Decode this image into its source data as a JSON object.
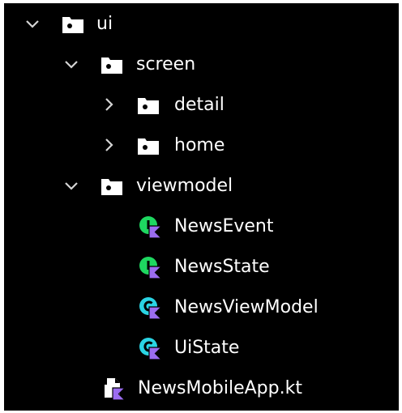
{
  "tree": {
    "ui": {
      "label": "ui",
      "expanded": true,
      "icon": "folder-icon"
    },
    "screen": {
      "label": "screen",
      "expanded": true,
      "icon": "folder-icon"
    },
    "detail": {
      "label": "detail",
      "expanded": false,
      "icon": "package-icon"
    },
    "home": {
      "label": "home",
      "expanded": false,
      "icon": "package-icon"
    },
    "viewmodel": {
      "label": "viewmodel",
      "expanded": true,
      "icon": "folder-icon"
    },
    "news_event": {
      "label": "NewsEvent",
      "icon": "kotlin-interface-icon"
    },
    "news_state": {
      "label": "NewsState",
      "icon": "kotlin-interface-icon"
    },
    "news_view_model": {
      "label": "NewsViewModel",
      "icon": "kotlin-class-icon"
    },
    "ui_state": {
      "label": "UiState",
      "icon": "kotlin-class-icon"
    },
    "news_mobile_app": {
      "label": "NewsMobileApp.kt",
      "icon": "kotlin-file-icon"
    }
  },
  "colors": {
    "background": "#000000",
    "text": "#ffffff",
    "interface_green": "#1ed760",
    "class_cyan": "#2ad4e4",
    "kotlin_purple": "#9b6cf0"
  }
}
